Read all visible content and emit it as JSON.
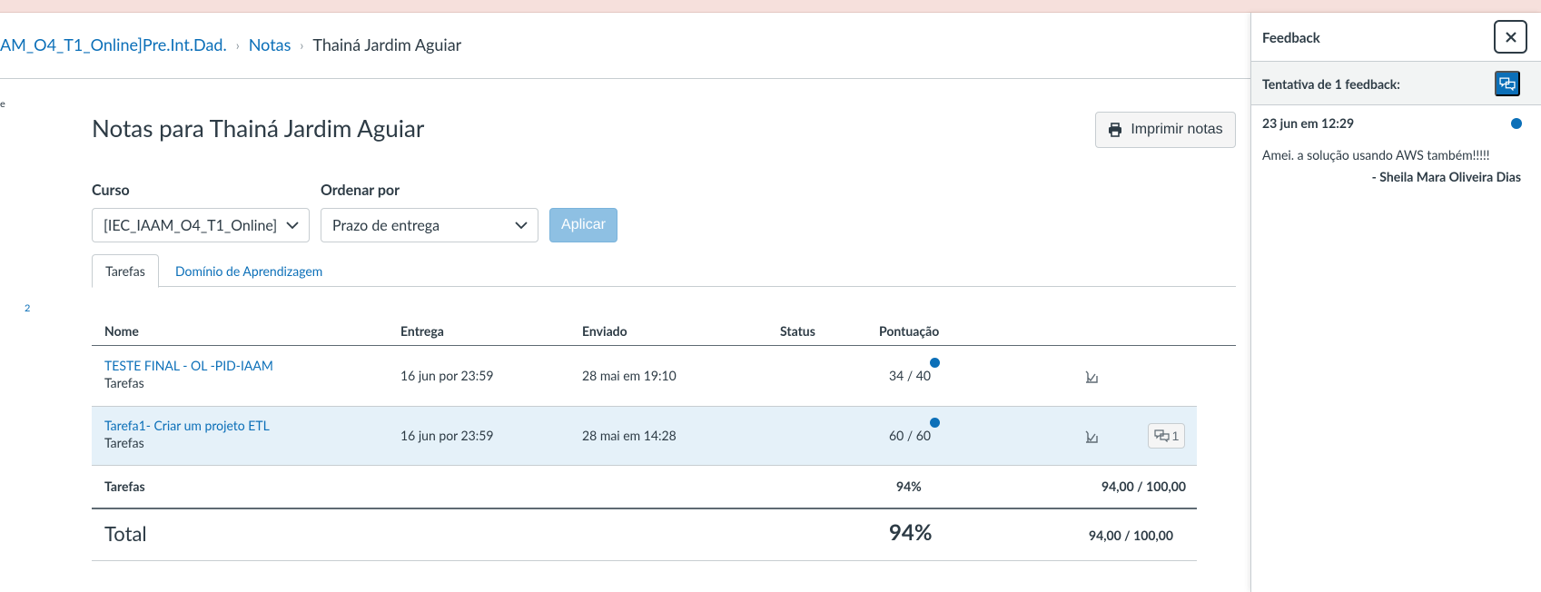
{
  "breadcrumb": {
    "course": "AM_O4_T1_Online]Pre.Int.Dad.",
    "section": "Notas",
    "current": "Thainá Jardim Aguiar"
  },
  "left_fragments": {
    "mark": "e",
    "number": "2"
  },
  "page": {
    "title": "Notas para Thainá Jardim Aguiar",
    "print_label": "Imprimir notas"
  },
  "filters": {
    "course_label": "Curso",
    "course_value": "[IEC_IAAM_O4_T1_Online]",
    "order_label": "Ordenar por",
    "order_value": "Prazo de entrega",
    "apply_label": "Aplicar"
  },
  "tabs": [
    {
      "label": "Tarefas",
      "active": true
    },
    {
      "label": "Domínio de Aprendizagem",
      "active": false
    }
  ],
  "table": {
    "headers": {
      "name": "Nome",
      "due": "Entrega",
      "submitted": "Enviado",
      "status": "Status",
      "score": "Pontuação"
    },
    "rows": [
      {
        "name": "TESTE FINAL - OL -PID-IAAM",
        "context": "Tarefas",
        "due": "16 jun por 23:59",
        "submitted": "28 mai em 19:10",
        "status": "",
        "score": "34 / 40",
        "unread": true,
        "feedback_count": ""
      },
      {
        "name": "Tarefa1- Criar um projeto ETL",
        "context": "Tarefas",
        "due": "16 jun por 23:59",
        "submitted": "28 mai em 14:28",
        "status": "",
        "score": "60 / 60",
        "unread": true,
        "feedback_count": "1"
      }
    ],
    "group": {
      "label": "Tarefas",
      "percent": "94%",
      "points": "94,00 / 100,00"
    },
    "total": {
      "label": "Total",
      "percent": "94%",
      "points": "94,00 / 100,00"
    }
  },
  "feedback": {
    "title": "Feedback",
    "attempt_label": "Tentativa de 1 feedback:",
    "date": "23 jun em 12:29",
    "comment": "Amei. a solução usando AWS também!!!!!",
    "author": "- Sheila Mara Oliveira Dias"
  },
  "colors": {
    "link": "#0b6fb8",
    "highlight_row": "#e5f1f9",
    "apply_disabled": "#8ec0e3",
    "text": "#2d3b45"
  },
  "icons": [
    "printer-icon",
    "chevron-down-icon",
    "what-if-icon",
    "feedback-icon",
    "close-icon"
  ]
}
